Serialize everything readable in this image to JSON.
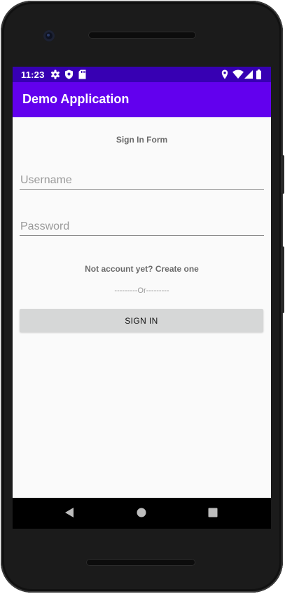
{
  "status_bar": {
    "time": "11:23",
    "icons_left": [
      "gear-icon",
      "shield-icon",
      "sd-card-icon"
    ],
    "icons_right": [
      "location-icon",
      "wifi-icon",
      "signal-icon",
      "battery-icon"
    ]
  },
  "app_bar": {
    "title": "Demo Application"
  },
  "form": {
    "title": "Sign In Form",
    "username": {
      "placeholder": "Username",
      "value": ""
    },
    "password": {
      "placeholder": "Password",
      "value": ""
    },
    "create_account_label": "Not account yet? Create one",
    "divider_label": "---------Or---------",
    "signin_label": "SIGN IN"
  },
  "nav_bar": {
    "items": [
      "back-icon",
      "home-icon",
      "recents-icon"
    ]
  },
  "colors": {
    "status_bar": "#3700b3",
    "app_bar": "#6200ee",
    "screen_background": "#fafafa",
    "button_background": "#d6d7d7"
  }
}
